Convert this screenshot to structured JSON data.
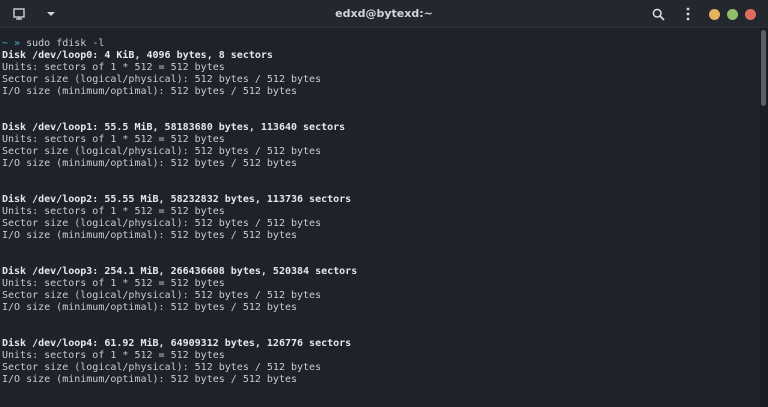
{
  "window": {
    "title": "edxd@bytexd:~"
  },
  "titlebar": {
    "icons": [
      "new-tab-icon",
      "dropdown-icon",
      "search-icon",
      "menu-icon"
    ],
    "controls": {
      "minimize_color": "#e5b25e",
      "maximize_color": "#8fbf6a",
      "close_color": "#e06c5e"
    }
  },
  "terminal": {
    "prompt_symbol": "~ »",
    "command": "sudo fdisk -l",
    "disks": [
      {
        "header": "Disk /dev/loop0: 4 KiB, 4096 bytes, 8 sectors",
        "units": "Units: sectors of 1 * 512 = 512 bytes",
        "sector_size": "Sector size (logical/physical): 512 bytes / 512 bytes",
        "io_size": "I/O size (minimum/optimal): 512 bytes / 512 bytes"
      },
      {
        "header": "Disk /dev/loop1: 55.5 MiB, 58183680 bytes, 113640 sectors",
        "units": "Units: sectors of 1 * 512 = 512 bytes",
        "sector_size": "Sector size (logical/physical): 512 bytes / 512 bytes",
        "io_size": "I/O size (minimum/optimal): 512 bytes / 512 bytes"
      },
      {
        "header": "Disk /dev/loop2: 55.55 MiB, 58232832 bytes, 113736 sectors",
        "units": "Units: sectors of 1 * 512 = 512 bytes",
        "sector_size": "Sector size (logical/physical): 512 bytes / 512 bytes",
        "io_size": "I/O size (minimum/optimal): 512 bytes / 512 bytes"
      },
      {
        "header": "Disk /dev/loop3: 254.1 MiB, 266436608 bytes, 520384 sectors",
        "units": "Units: sectors of 1 * 512 = 512 bytes",
        "sector_size": "Sector size (logical/physical): 512 bytes / 512 bytes",
        "io_size": "I/O size (minimum/optimal): 512 bytes / 512 bytes"
      },
      {
        "header": "Disk /dev/loop4: 61.92 MiB, 64909312 bytes, 126776 sectors",
        "units": "Units: sectors of 1 * 512 = 512 bytes",
        "sector_size": "Sector size (logical/physical): 512 bytes / 512 bytes",
        "io_size": "I/O size (minimum/optimal): 512 bytes / 512 bytes"
      }
    ]
  }
}
